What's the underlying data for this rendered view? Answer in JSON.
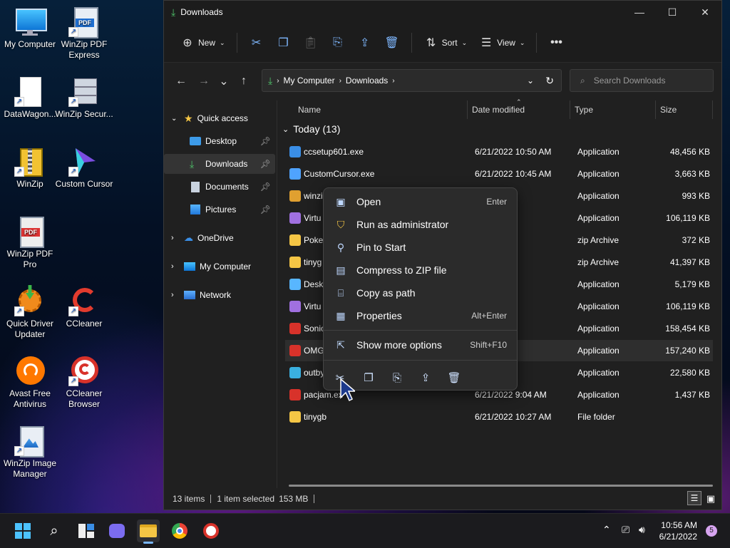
{
  "colors": {
    "accent": "#7ab7ff",
    "folder": "#f5c645",
    "selection": "#343434"
  },
  "desktop": {
    "icons": [
      {
        "label": "My Computer",
        "icon": "monitor-icon"
      },
      {
        "label": "WinZip PDF Express",
        "icon": "pdf-icon"
      },
      {
        "label": "DataWagon...",
        "icon": "file-icon"
      },
      {
        "label": "WinZip Secur...",
        "icon": "server-icon"
      },
      {
        "label": "WinZip",
        "icon": "zip-icon"
      },
      {
        "label": "Custom Cursor",
        "icon": "cursor-icon"
      },
      {
        "label": "WinZip PDF Pro",
        "icon": "pdf-icon"
      },
      {
        "label": "Quick Driver Updater",
        "icon": "gear-icon"
      },
      {
        "label": "CCleaner",
        "icon": "ccleaner-icon"
      },
      {
        "label": "Avast Free Antivirus",
        "icon": "avast-icon"
      },
      {
        "label": "CCleaner Browser",
        "icon": "browser-icon"
      },
      {
        "label": "WinZip Image Manager",
        "icon": "image-icon"
      }
    ]
  },
  "window": {
    "title": "Downloads",
    "toolbar": {
      "new": "New",
      "sort": "Sort",
      "view": "View"
    },
    "address": {
      "root": "My Computer",
      "current": "Downloads"
    },
    "search": {
      "placeholder": "Search Downloads"
    },
    "sidebar": {
      "quick_access": "Quick access",
      "items": [
        "Desktop",
        "Downloads",
        "Documents",
        "Pictures"
      ],
      "onedrive": "OneDrive",
      "mycomputer": "My Computer",
      "network": "Network"
    },
    "columns": {
      "name": "Name",
      "date": "Date modified",
      "type": "Type",
      "size": "Size"
    },
    "group": "Today (13)",
    "files": [
      {
        "name": "ccsetup601.exe",
        "date": "6/21/2022 10:50 AM",
        "type": "Application",
        "size": "48,456 KB"
      },
      {
        "name": "CustomCursor.exe",
        "date": "6/21/2022 10:45 AM",
        "type": "Application",
        "size": "3,663 KB"
      },
      {
        "name": "winzi",
        "date": "0:38 AM",
        "type": "Application",
        "size": "993 KB"
      },
      {
        "name": "Virtu",
        "date": "0:37 AM",
        "type": "Application",
        "size": "106,119 KB"
      },
      {
        "name": "Poke",
        "date": "0:26 AM",
        "type": "zip Archive",
        "size": "372 KB"
      },
      {
        "name": "tinyg",
        "date": "0:24 AM",
        "type": "zip Archive",
        "size": "41,397 KB"
      },
      {
        "name": "Deskt",
        "date": ":10 AM",
        "type": "Application",
        "size": "5,179 KB"
      },
      {
        "name": "Virtu",
        "date": ":09 AM",
        "type": "Application",
        "size": "106,119 KB"
      },
      {
        "name": "Sonic",
        "date": ":09 AM",
        "type": "Application",
        "size": "158,454 KB"
      },
      {
        "name": "OMG",
        "date": ":07 AM",
        "type": "Application",
        "size": "157,240 KB"
      },
      {
        "name": "outby",
        "date": ":05 AM",
        "type": "Application",
        "size": "22,580 KB"
      },
      {
        "name": "pacjam.ex",
        "date": "6/21/2022 9:04 AM",
        "type": "Application",
        "size": "1,437 KB"
      },
      {
        "name": "tinygb",
        "date": "6/21/2022 10:27 AM",
        "type": "File folder",
        "size": ""
      }
    ],
    "status": {
      "count": "13 items",
      "selected": "1 item selected",
      "size": "153 MB"
    }
  },
  "context_menu": {
    "items": [
      {
        "label": "Open",
        "shortcut": "Enter",
        "icon": "open-icon"
      },
      {
        "label": "Run as administrator",
        "shortcut": "",
        "icon": "shield-icon"
      },
      {
        "label": "Pin to Start",
        "shortcut": "",
        "icon": "pin-icon"
      },
      {
        "label": "Compress to ZIP file",
        "shortcut": "",
        "icon": "zip-icon"
      },
      {
        "label": "Copy as path",
        "shortcut": "",
        "icon": "path-icon"
      },
      {
        "label": "Properties",
        "shortcut": "Alt+Enter",
        "icon": "properties-icon"
      }
    ],
    "more": {
      "label": "Show more options",
      "shortcut": "Shift+F10"
    }
  },
  "taskbar": {
    "time": "10:56 AM",
    "date": "6/21/2022",
    "notifications": "5"
  }
}
